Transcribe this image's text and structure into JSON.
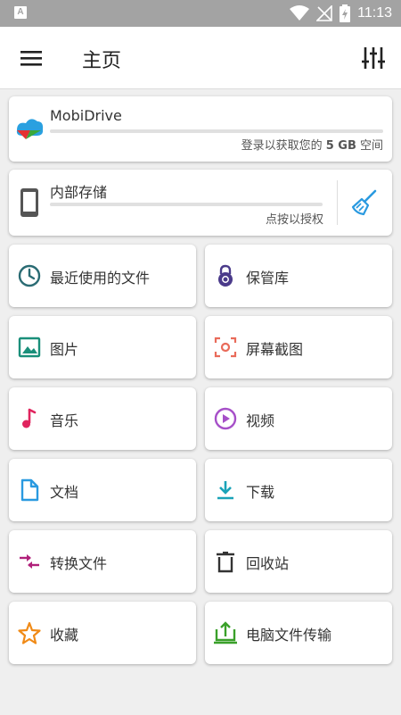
{
  "status_bar": {
    "time": "11:13",
    "left_badge": "A"
  },
  "app_bar": {
    "title": "主页"
  },
  "mobidrive": {
    "name": "MobiDrive",
    "usage": 0.0,
    "subtitle_prefix": "登录以获取您的 ",
    "subtitle_size": "5 GB",
    "subtitle_suffix": " 空间"
  },
  "storage": {
    "name": "内部存储",
    "usage": 0.0,
    "subtitle": "点按以授权"
  },
  "tiles": [
    {
      "label": "最近使用的文件",
      "icon": "clock-icon",
      "color": "#2a6b73"
    },
    {
      "label": "保管库",
      "icon": "lock-icon",
      "color": "#4a3a8a"
    },
    {
      "label": "图片",
      "icon": "image-icon",
      "color": "#1a8f7a"
    },
    {
      "label": "屏幕截图",
      "icon": "screenshot-icon",
      "color": "#e96b5a"
    },
    {
      "label": "音乐",
      "icon": "music-icon",
      "color": "#e0245e"
    },
    {
      "label": "视频",
      "icon": "video-icon",
      "color": "#a64fc8"
    },
    {
      "label": "文档",
      "icon": "document-icon",
      "color": "#2a9ae0"
    },
    {
      "label": "下载",
      "icon": "download-icon",
      "color": "#1aa3b8"
    },
    {
      "label": "转换文件",
      "icon": "convert-icon",
      "color": "#b0207a"
    },
    {
      "label": "回收站",
      "icon": "trash-icon",
      "color": "#333333"
    },
    {
      "label": "收藏",
      "icon": "star-icon",
      "color": "#f08a16"
    },
    {
      "label": "电脑文件传输",
      "icon": "pc-transfer-icon",
      "color": "#3aa02a"
    }
  ]
}
